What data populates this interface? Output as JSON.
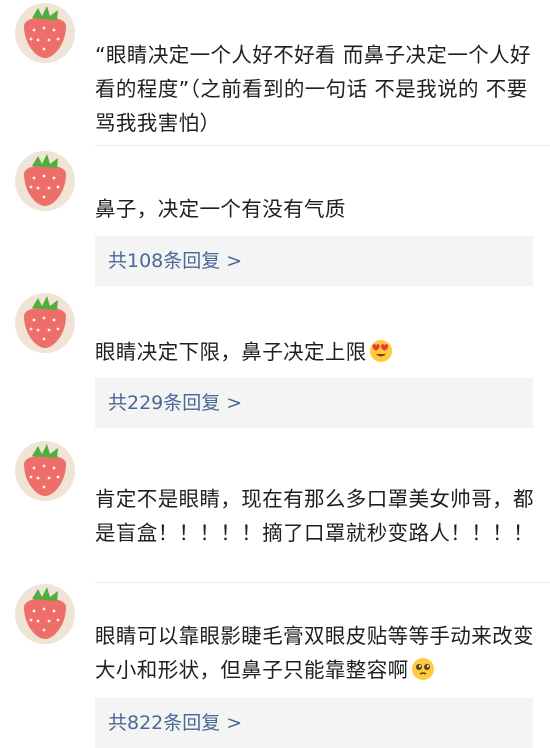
{
  "comments": [
    {
      "text": "“眼睛决定一个人好不好看 而鼻子决定一个人好看的程度”（之前看到的一句话 不是我说的 不要骂我我害怕）"
    },
    {
      "text": "鼻子，决定一个有没有气质",
      "reply_count": "共108条回复 >"
    },
    {
      "text": "眼睛决定下限，鼻子决定上限",
      "emoji": "heart-eyes-emoji",
      "reply_count": "共229条回复 >"
    },
    {
      "text": "肯定不是眼睛，现在有那么多口罩美女帅哥，都是盲盒！！！！！摘了口罩就秒变路人！！！！"
    },
    {
      "text": "眼睛可以靠眼影睫毛膏双眼皮贴等等手动来改变大小和形状，但鼻子只能靠整容啊",
      "emoji": "pleading-face-emoji",
      "reply_count": "共822条回复 >"
    }
  ],
  "colors": {
    "reply_link": "#496896",
    "reply_bg": "#f4f4f4",
    "strawberry": "#ee6f6a",
    "leaf": "#4fae3c"
  },
  "avatar_icon": "strawberry-icon"
}
